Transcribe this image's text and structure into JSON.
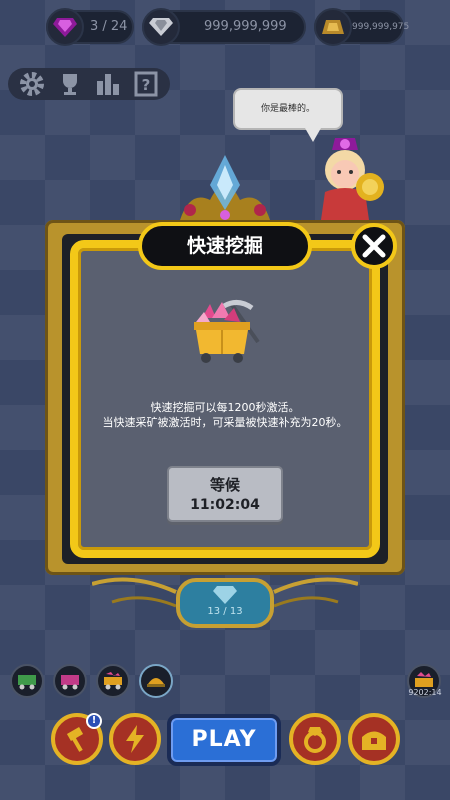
{
  "resources": {
    "gems": "3 / 24",
    "diamonds": "999,999,999",
    "gold": "999,999,975"
  },
  "toolbar": {
    "items": [
      "gear-icon",
      "trophy-icon",
      "leaderboard-icon",
      "quest-icon"
    ]
  },
  "speech_bubble": "你是最棒的。",
  "modal": {
    "title": "快速挖掘",
    "description_line1": "快速挖掘可以每1200秒激活。",
    "description_line2": "当快速采矿被激活时，可采量被快速补充为20秒。",
    "wait_label": "等候",
    "wait_timer": "11:02:04"
  },
  "medal_count": "13 / 13",
  "side_timer": "9202:14",
  "play_label": "PLAY",
  "colors": {
    "gold": "#f3c818",
    "panel": "#5a6070",
    "play": "#2b6fd6",
    "button_red": "#a53124"
  }
}
